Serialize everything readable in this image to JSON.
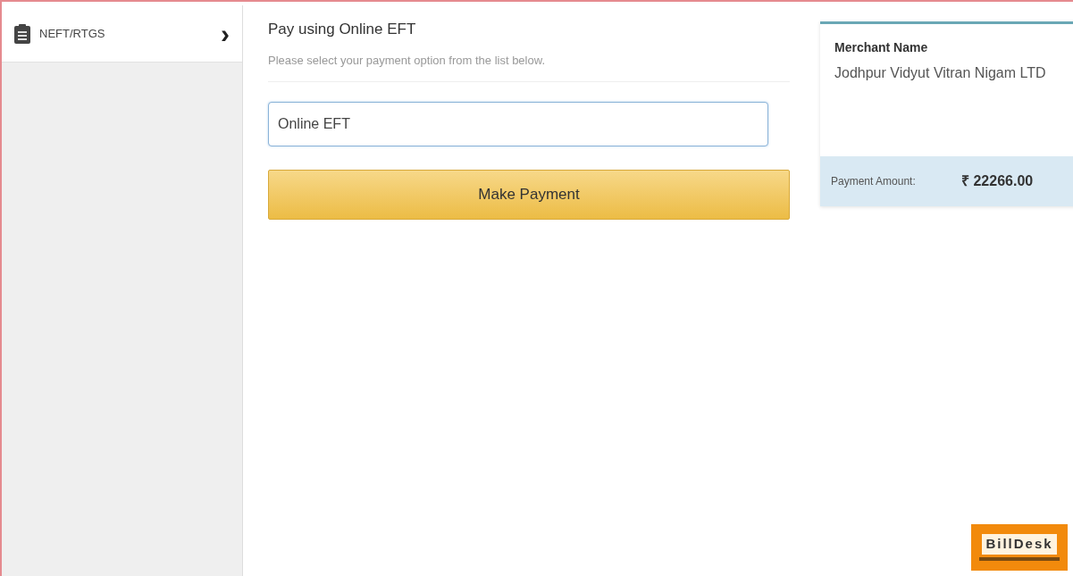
{
  "sidebar": {
    "items": [
      {
        "label": "NEFT/RTGS",
        "chevron": "›"
      }
    ]
  },
  "main": {
    "title": "Pay using Online EFT",
    "subtitle": "Please select your payment option from the list below.",
    "option_field": {
      "value": "Online EFT"
    },
    "button": "Make Payment"
  },
  "summary": {
    "merchant_label": "Merchant Name",
    "merchant_name": "Jodhpur Vidyut Vitran Nigam LTD",
    "amount_label": "Payment Amount:",
    "amount": "₹ 22266.00"
  },
  "footer_logo": {
    "text": "BillDesk"
  }
}
